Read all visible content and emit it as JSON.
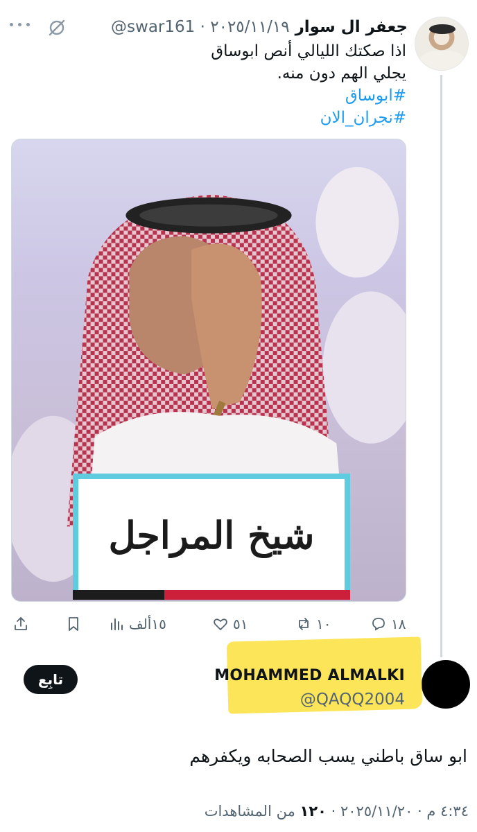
{
  "quoted_tweet": {
    "author_name": "جعفر ال سوار",
    "handle": "@swar161",
    "date": "٢٠٢٥/١١/١٩",
    "separator": "·",
    "text_lines": [
      "اذا صكتك الليالي أنص ابوساق",
      "يجلي الهم دون منه."
    ],
    "hashtags": [
      "#ابوساق",
      "#نجران_الان"
    ],
    "media_caption": "شيخ المراجل",
    "actions": {
      "replies": "١٨",
      "retweets": "١٠",
      "likes": "٥١",
      "views": "١٥ألف"
    }
  },
  "reply_tweet": {
    "author_name": "MOHAMMED ALMALKI",
    "handle": "@QAQQ2004",
    "follow_label": "تابِع",
    "text": "ابو ساق باطني يسب الصحابه ويكفرهم",
    "timestamp": "٤:٣٤ م · ٢٠٢٥/١١/٢٠ · ",
    "views_count": "١٢٠",
    "views_label": " من المشاهدات"
  },
  "colors": {
    "accent": "#1d9bf0",
    "highlight": "#fde34c",
    "secondary_text": "#536471"
  }
}
